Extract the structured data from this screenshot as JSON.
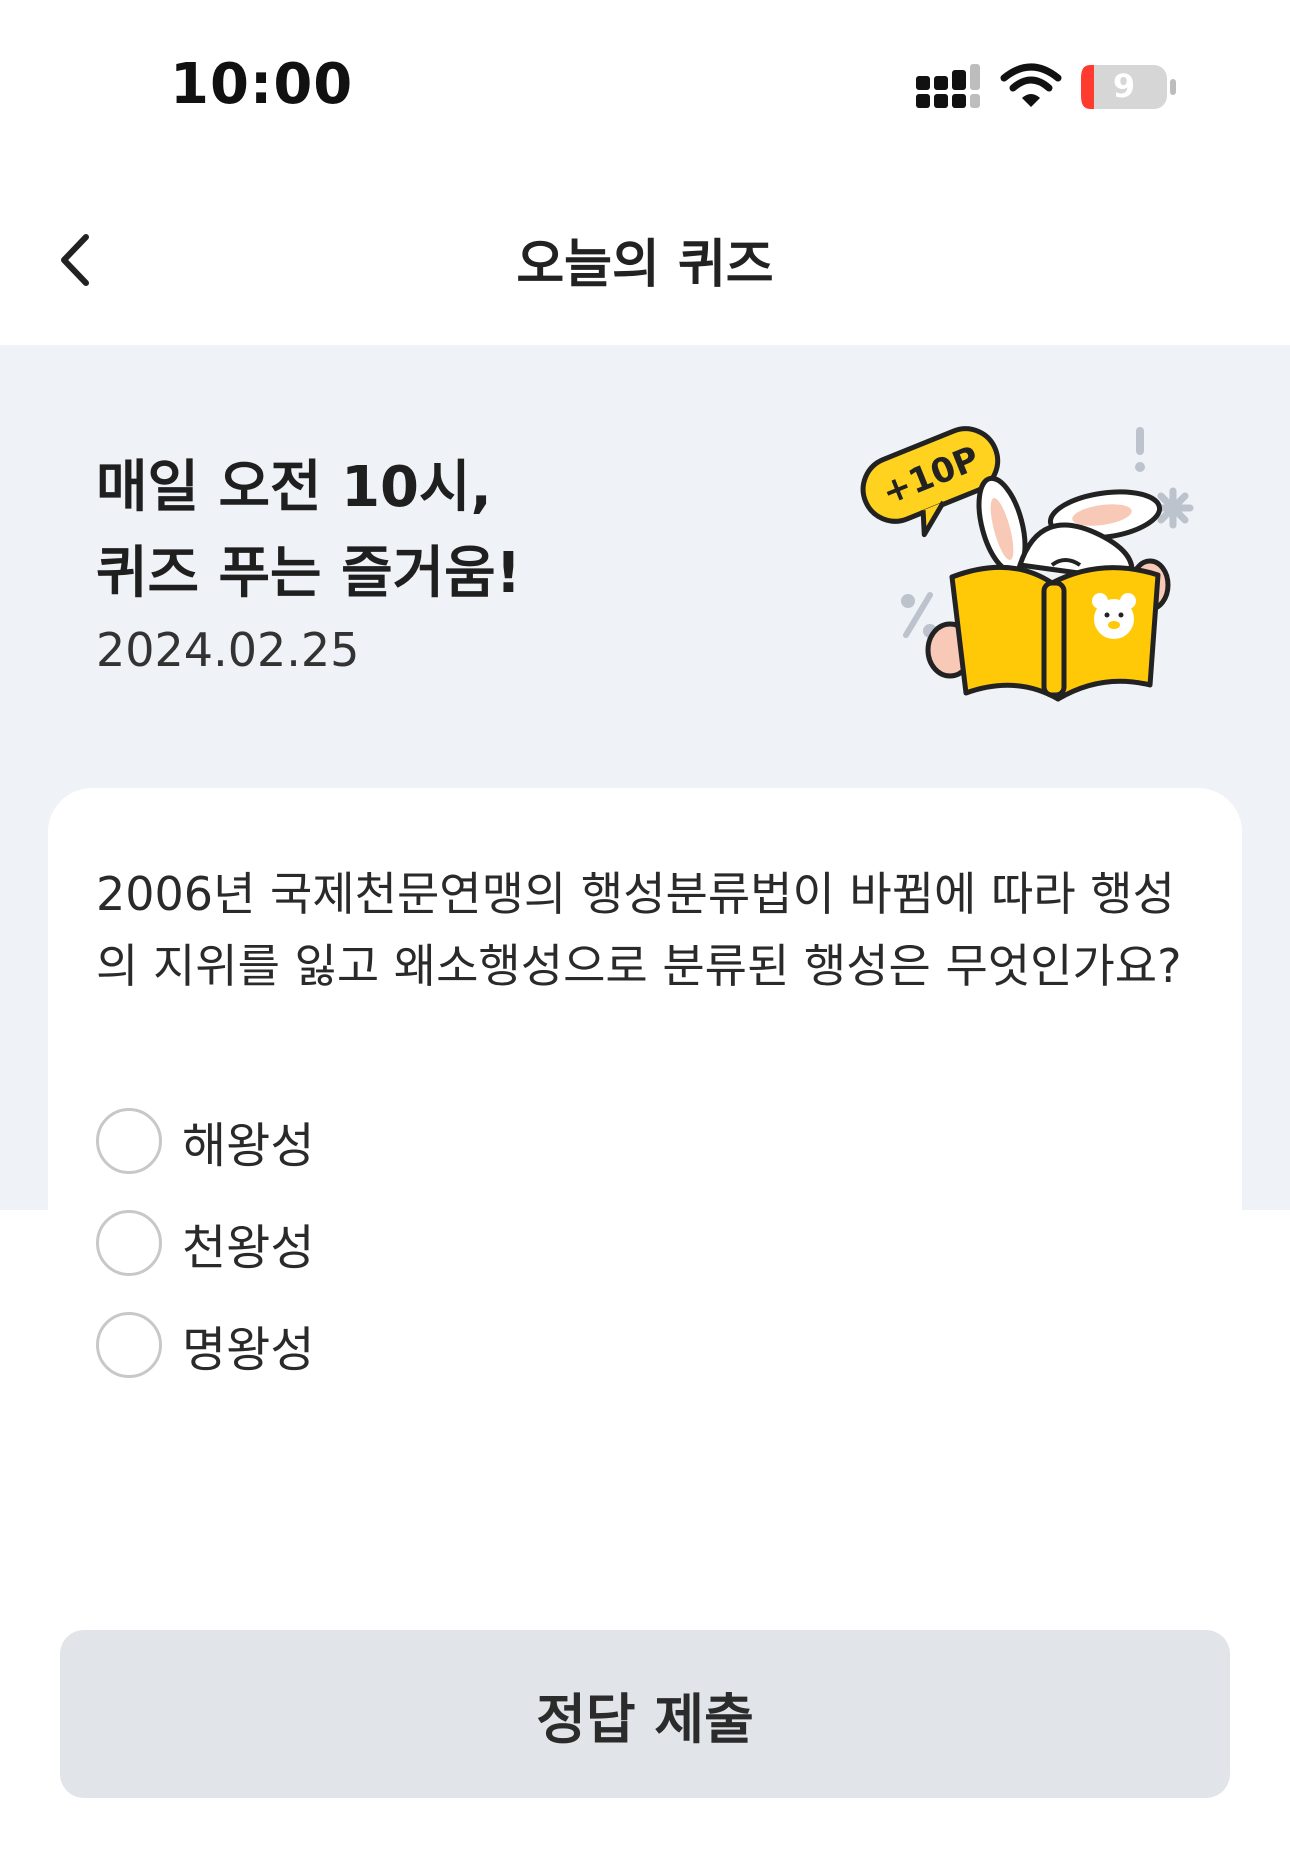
{
  "status_bar": {
    "time": "10:00",
    "battery_level": "9",
    "icons": [
      "signal-icon",
      "wifi-icon",
      "battery-icon"
    ]
  },
  "nav": {
    "title": "오늘의 퀴즈",
    "back_icon": "chevron-left-icon"
  },
  "hero": {
    "title_line1": "매일 오전 10시,",
    "title_line2": "퀴즈 푸는 즐거움!",
    "date": "2024.02.25",
    "badge_text": "+10P"
  },
  "quiz": {
    "question": "2006년 국제천문연맹의 행성분류법이 바뀜에 따라 행성의 지위를 잃고 왜소행성으로 분류된 행성은 무엇인가요?",
    "options": [
      "해왕성",
      "천왕성",
      "명왕성"
    ]
  },
  "submit": {
    "label": "정답 제출"
  },
  "colors": {
    "hero_background": "#eff2f6",
    "button_background": "#e1e4e8",
    "badge_yellow": "#ffd21f",
    "battery_red": "#ff3b30"
  }
}
